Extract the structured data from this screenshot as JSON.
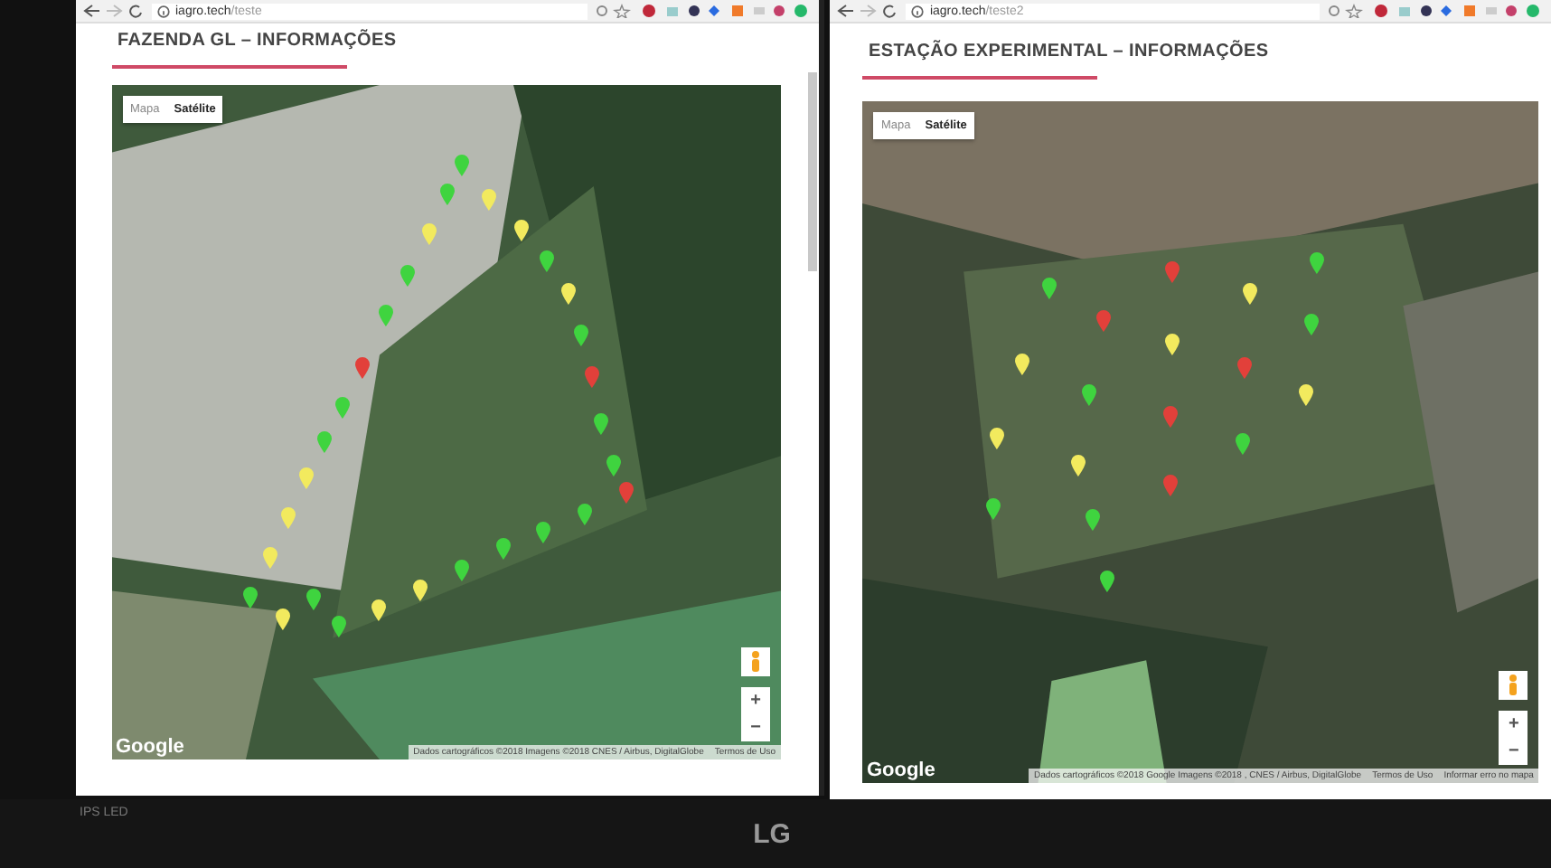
{
  "windows": [
    {
      "url_host": "iagro.tech",
      "url_path": "/teste",
      "title": "FAZENDA GL – INFORMAÇÕES",
      "map": {
        "type_buttons": [
          {
            "label": "Mapa",
            "selected": false
          },
          {
            "label": "Satélite",
            "selected": true
          }
        ],
        "zoom_in": "+",
        "zoom_out": "−",
        "logo": "Google",
        "attribution": [
          "Dados cartográficos ©2018 Imagens ©2018 CNES / Airbus, DigitalGlobe",
          "Termos de Uso"
        ],
        "markers": [
          {
            "color": "#3fd43f"
          },
          {
            "color": "#3fd43f"
          },
          {
            "color": "#f2ea5e"
          },
          {
            "color": "#f2ea5e"
          },
          {
            "color": "#f2ea5e"
          },
          {
            "color": "#3fd43f"
          },
          {
            "color": "#3fd43f"
          },
          {
            "color": "#f2ea5e"
          },
          {
            "color": "#3fd43f"
          },
          {
            "color": "#3fd43f"
          },
          {
            "color": "#e2403a"
          },
          {
            "color": "#e2403a"
          },
          {
            "color": "#3fd43f"
          },
          {
            "color": "#3fd43f"
          },
          {
            "color": "#3fd43f"
          },
          {
            "color": "#3fd43f"
          },
          {
            "color": "#f2ea5e"
          },
          {
            "color": "#e2403a"
          },
          {
            "color": "#3fd43f"
          },
          {
            "color": "#f2ea5e"
          },
          {
            "color": "#3fd43f"
          },
          {
            "color": "#f2ea5e"
          },
          {
            "color": "#3fd43f"
          },
          {
            "color": "#3fd43f"
          },
          {
            "color": "#3fd43f"
          },
          {
            "color": "#f2ea5e"
          },
          {
            "color": "#3fd43f"
          },
          {
            "color": "#f2ea5e"
          },
          {
            "color": "#f2ea5e"
          },
          {
            "color": "#3fd43f"
          }
        ]
      }
    },
    {
      "url_host": "iagro.tech",
      "url_path": "/teste2",
      "title": "ESTAÇÃO EXPERIMENTAL – INFORMAÇÕES",
      "map": {
        "type_buttons": [
          {
            "label": "Mapa",
            "selected": false
          },
          {
            "label": "Satélite",
            "selected": true
          }
        ],
        "zoom_in": "+",
        "zoom_out": "−",
        "logo": "Google",
        "attribution": [
          "Dados cartográficos ©2018 Google Imagens ©2018 , CNES / Airbus, DigitalGlobe",
          "Termos de Uso",
          "Informar erro no mapa"
        ],
        "markers": [
          {
            "color": "#3fd43f"
          },
          {
            "color": "#e2403a"
          },
          {
            "color": "#f2ea5e"
          },
          {
            "color": "#3fd43f"
          },
          {
            "color": "#e2403a"
          },
          {
            "color": "#3fd43f"
          },
          {
            "color": "#f2ea5e"
          },
          {
            "color": "#f2ea5e"
          },
          {
            "color": "#e2403a"
          },
          {
            "color": "#f2ea5e"
          },
          {
            "color": "#3fd43f"
          },
          {
            "color": "#e2403a"
          },
          {
            "color": "#f2ea5e"
          },
          {
            "color": "#3fd43f"
          },
          {
            "color": "#f2ea5e"
          },
          {
            "color": "#e2403a"
          },
          {
            "color": "#3fd43f"
          },
          {
            "color": "#3fd43f"
          },
          {
            "color": "#3fd43f"
          }
        ]
      }
    }
  ],
  "monitor": {
    "badge": "IPS LED",
    "brand": "LG"
  }
}
